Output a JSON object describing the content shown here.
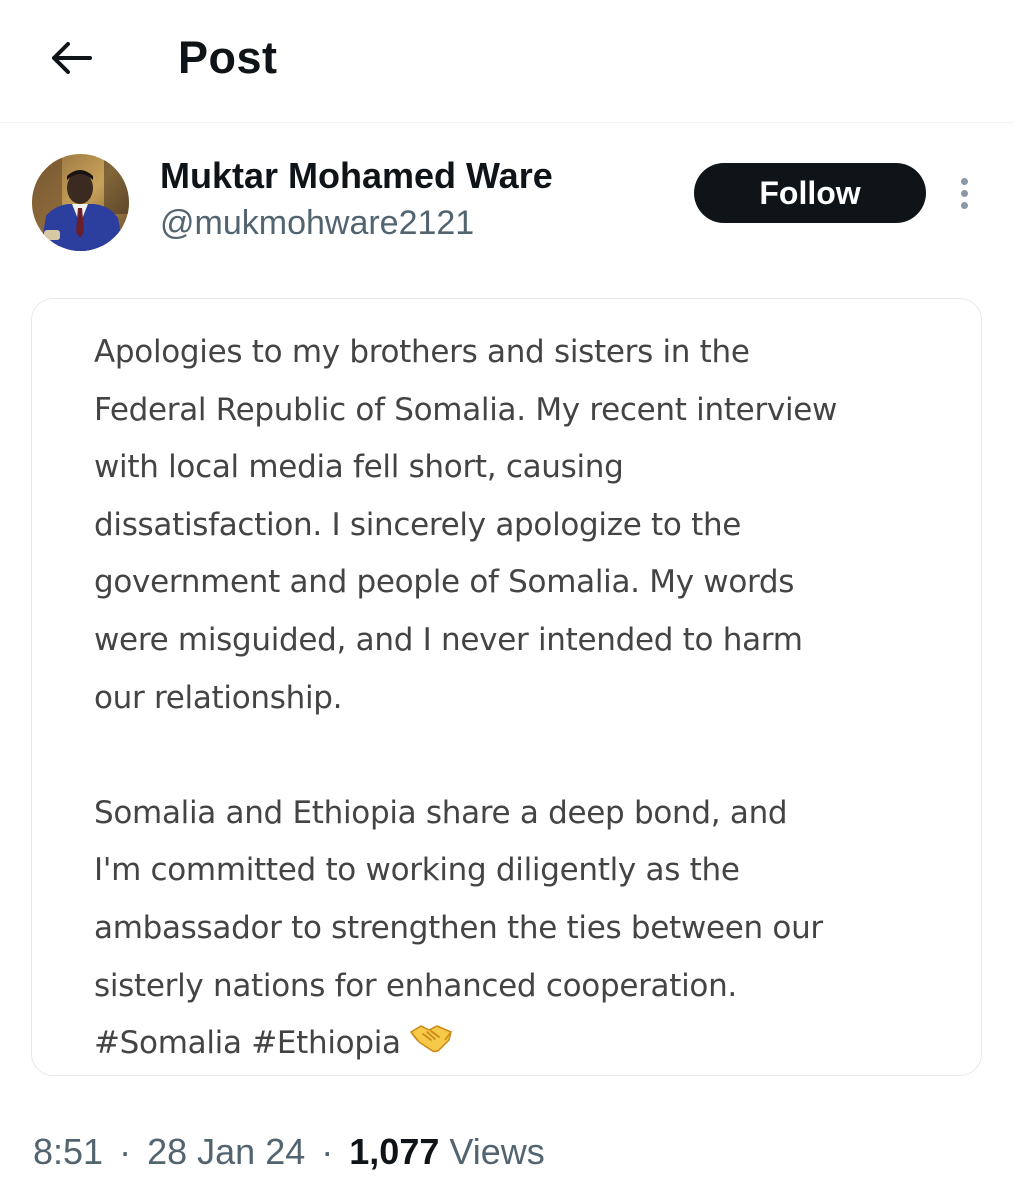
{
  "header": {
    "title": "Post"
  },
  "author": {
    "name": "Muktar Mohamed Ware",
    "handle": "@mukmohware2121"
  },
  "actions": {
    "follow_label": "Follow"
  },
  "post": {
    "paragraph_1": "Apologies to my brothers and sisters in the\nFederal Republic of Somalia. My recent interview\nwith local media fell short, causing\ndissatisfaction. I sincerely apologize to the\ngovernment and people of Somalia. My words\nwere misguided, and I never intended to harm\nour relationship.",
    "paragraph_2": "Somalia and Ethiopia share a deep bond, and\nI'm committed to working diligently as the\nambassador to strengthen the ties between our\nsisterly nations for enhanced cooperation.",
    "hashtags": [
      "#Somalia",
      "#Ethiopia"
    ],
    "emoji": "handshake-emoji"
  },
  "meta": {
    "time": "8:51",
    "date": "28 Jan 24",
    "views_count": "1,077",
    "views_label": "Views",
    "separator": "·"
  },
  "icons": {
    "back": "arrow-left-icon",
    "more": "more-vertical-icon"
  },
  "colors": {
    "text_primary": "#0f1419",
    "text_secondary": "#536471",
    "follow_bg": "#0f1419",
    "follow_text": "#ffffff",
    "card_border": "#e6e9eb",
    "post_text": "#444444"
  }
}
